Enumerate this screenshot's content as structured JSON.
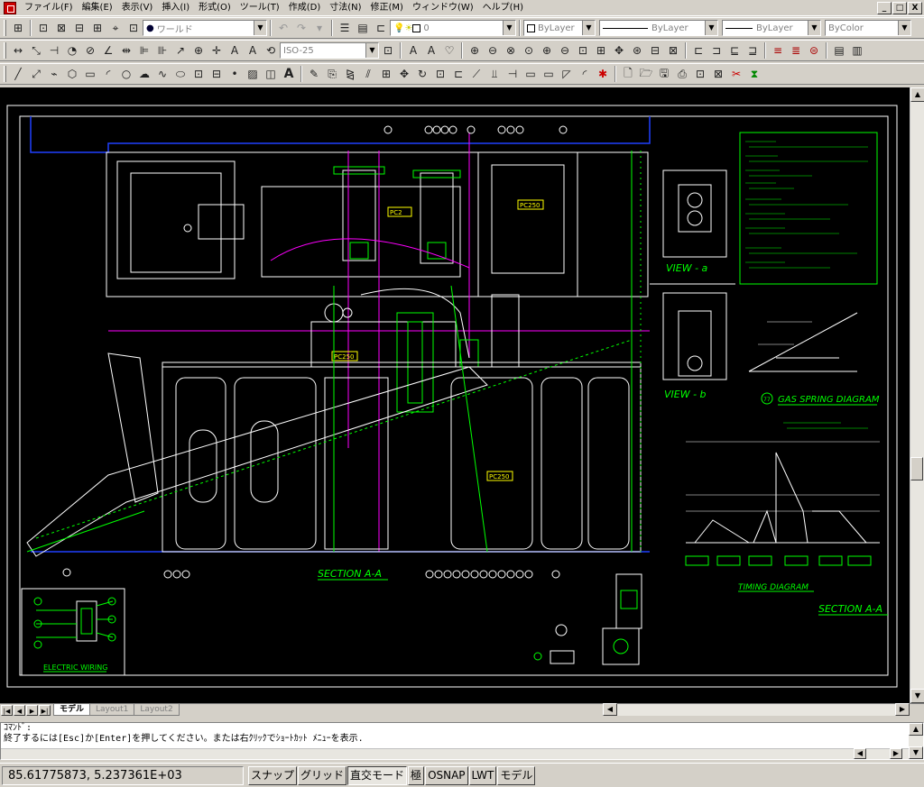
{
  "menu": {
    "items": [
      "ファイル(F)",
      "編集(E)",
      "表示(V)",
      "挿入(I)",
      "形式(O)",
      "ツール(T)",
      "作成(D)",
      "寸法(N)",
      "修正(M)",
      "ウィンドウ(W)",
      "ヘルプ(H)"
    ],
    "window_buttons": [
      "_",
      "□",
      "X"
    ]
  },
  "toolbar_standard": {
    "named_view_combo": "ワールド",
    "layer_combo": "0",
    "color_combo": "ByLayer",
    "linetype_combo": "ByLayer",
    "lineweight_combo": "ByLayer",
    "plotstyle_combo": "ByColor"
  },
  "toolbar_dim": {
    "dimstyle_combo": "ISO-25",
    "text_tool_label": "A"
  },
  "layout_tabs": {
    "tabs": [
      "モデル",
      "Layout1",
      "Layout2"
    ],
    "active": 0
  },
  "command_line": {
    "line1": "ｺﾏﾝﾄﾞ:",
    "line2": "終了するには[Esc]か[Enter]を押してください。または右ｸﾘｯｸでｼｮｰﾄｶｯﾄ ﾒﾆｭｰを表示."
  },
  "status_bar": {
    "coordinates": "85.61775873,  5.237361E+03",
    "toggles": [
      {
        "label": "スナップ",
        "on": false
      },
      {
        "label": "グリッド",
        "on": false
      },
      {
        "label": "直交モード",
        "on": true
      },
      {
        "label": "極",
        "on": false
      },
      {
        "label": "OSNAP",
        "on": false
      },
      {
        "label": "LWT",
        "on": false
      },
      {
        "label": "モデル",
        "on": false
      }
    ]
  },
  "drawing": {
    "title_section_main": "SECTION A-A",
    "title_section_right": "SECTION A-A",
    "view_a": "VIEW - a",
    "view_b": "VIEW - b",
    "gas_spring": "GAS SPRING DIAGRAM",
    "gas_spring_number": "77",
    "timing": "TIMING DIAGRAM",
    "electric": "ELECTRIC WIRING",
    "label_a": "PC2",
    "label_b": "PC250",
    "label_c": "PC250",
    "label_d": "PC250"
  },
  "colors": {
    "canvas": "#000000",
    "green": "#00ff00",
    "white": "#ffffff",
    "magenta": "#ff00ff",
    "blue": "#0000ff",
    "yellow": "#ffff00"
  }
}
